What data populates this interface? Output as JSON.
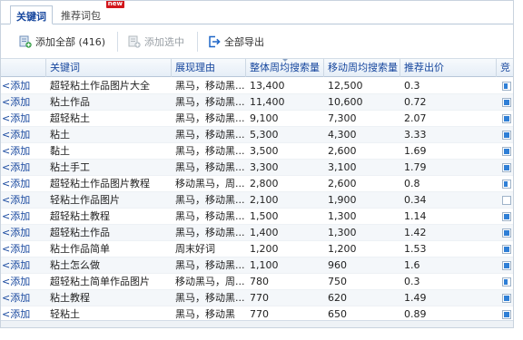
{
  "tabs": {
    "keywords": "关键词",
    "recommended": "推荐词包",
    "new_badge": "new"
  },
  "toolbar": {
    "add_all": "添加全部 (416)",
    "add_selected": "添加选中",
    "export_all": "全部导出"
  },
  "columns": [
    "",
    "关键词",
    "展现理由",
    "整体周均搜索量",
    "移动周均搜索量",
    "推荐出价",
    "竞"
  ],
  "add_label": "<添加",
  "rows": [
    {
      "kw": "超轻粘土作品图片大全",
      "reason": "黑马，移动黑...",
      "total": "13,400",
      "mobile": "12,500",
      "bid": "0.3",
      "level": 0.7
    },
    {
      "kw": "粘土作品",
      "reason": "黑马，移动黑...",
      "total": "11,400",
      "mobile": "10,600",
      "bid": "0.72",
      "level": 1
    },
    {
      "kw": "超轻粘土",
      "reason": "黑马，移动黑...",
      "total": "9,100",
      "mobile": "7,300",
      "bid": "2.07",
      "level": 1
    },
    {
      "kw": "粘土",
      "reason": "黑马，移动黑...",
      "total": "5,300",
      "mobile": "4,300",
      "bid": "3.33",
      "level": 1
    },
    {
      "kw": "黏土",
      "reason": "黑马，移动黑...",
      "total": "3,500",
      "mobile": "2,600",
      "bid": "1.69",
      "level": 1
    },
    {
      "kw": "粘土手工",
      "reason": "黑马，移动黑...",
      "total": "3,300",
      "mobile": "3,100",
      "bid": "1.79",
      "level": 1
    },
    {
      "kw": "超轻粘土作品图片教程",
      "reason": "移动黑马，周...",
      "total": "2,800",
      "mobile": "2,600",
      "bid": "0.8",
      "level": 0.7
    },
    {
      "kw": "轻粘土作品图片",
      "reason": "黑马，移动黑...",
      "total": "2,100",
      "mobile": "1,900",
      "bid": "0.34",
      "level": 0
    },
    {
      "kw": "超轻粘土教程",
      "reason": "黑马，移动黑...",
      "total": "1,500",
      "mobile": "1,300",
      "bid": "1.14",
      "level": 1
    },
    {
      "kw": "超轻粘土作品",
      "reason": "黑马，移动黑...",
      "total": "1,400",
      "mobile": "1,300",
      "bid": "1.42",
      "level": 1
    },
    {
      "kw": "粘土作品简单",
      "reason": "周末好词",
      "total": "1,200",
      "mobile": "1,200",
      "bid": "1.53",
      "level": 1
    },
    {
      "kw": "粘土怎么做",
      "reason": "黑马，移动黑...",
      "total": "1,100",
      "mobile": "960",
      "bid": "1.6",
      "level": 1
    },
    {
      "kw": "超轻粘土简单作品图片",
      "reason": "移动黑马，周...",
      "total": "780",
      "mobile": "750",
      "bid": "0.3",
      "level": 0.7
    },
    {
      "kw": "粘土教程",
      "reason": "黑马，移动黑...",
      "total": "770",
      "mobile": "620",
      "bid": "1.49",
      "level": 1
    },
    {
      "kw": "轻粘土",
      "reason": "黑马，移动黑",
      "total": "770",
      "mobile": "650",
      "bid": "0.89",
      "level": 1
    }
  ],
  "colors": {
    "accent": "#17479e",
    "badge": "#d2161c",
    "bar": "#2f7fd6"
  }
}
